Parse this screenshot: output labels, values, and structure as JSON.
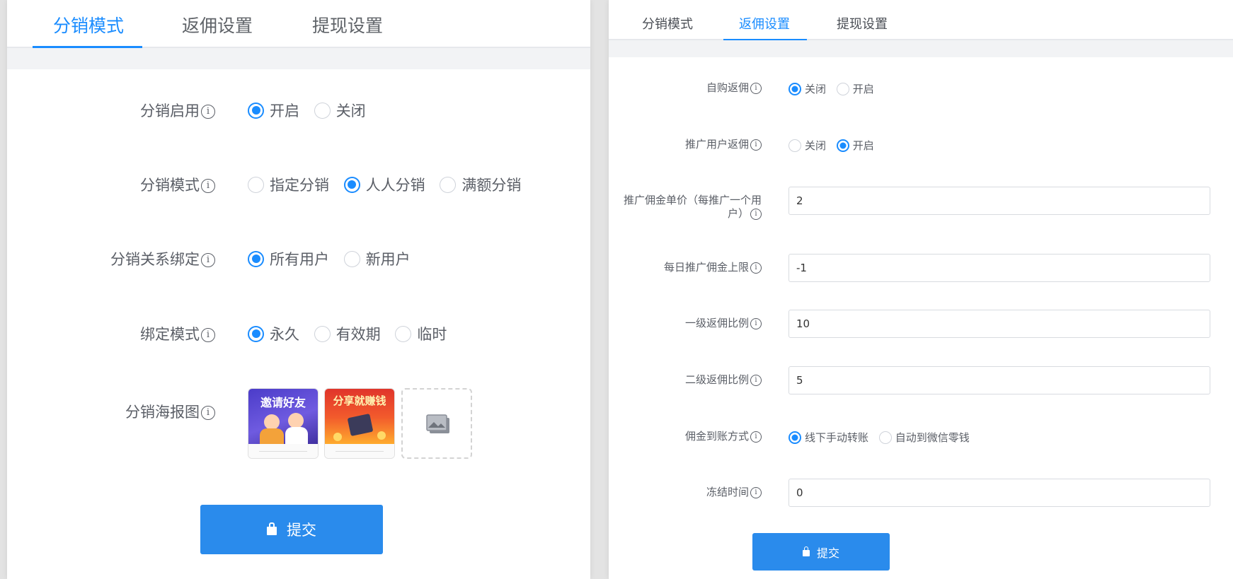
{
  "left_panel": {
    "tabs": [
      "分销模式",
      "返佣设置",
      "提现设置"
    ],
    "active_tab": "分销模式",
    "fields": {
      "enable": {
        "label": "分销启用",
        "options": [
          "开启",
          "关闭"
        ],
        "selected": "开启"
      },
      "mode": {
        "label": "分销模式",
        "options": [
          "指定分销",
          "人人分销",
          "满额分销"
        ],
        "selected": "人人分销"
      },
      "binding": {
        "label": "分销关系绑定",
        "options": [
          "所有用户",
          "新用户"
        ],
        "selected": "所有用户"
      },
      "bind_mode": {
        "label": "绑定模式",
        "options": [
          "永久",
          "有效期",
          "临时"
        ],
        "selected": "永久"
      },
      "poster": {
        "label": "分销海报图",
        "images": [
          "邀请好友",
          "分享就赚钱"
        ]
      }
    },
    "submit_label": "提交"
  },
  "right_panel": {
    "tabs": [
      "分销模式",
      "返佣设置",
      "提现设置"
    ],
    "active_tab": "返佣设置",
    "fields": {
      "self_purchase": {
        "label": "自购返佣",
        "options": [
          "关闭",
          "开启"
        ],
        "selected": "关闭"
      },
      "promote_user": {
        "label": "推广用户返佣",
        "options": [
          "关闭",
          "开启"
        ],
        "selected": "开启"
      },
      "unit_price": {
        "label_line1": "推广佣金单价（每推广一个用",
        "label_line2": "户）",
        "value": "2"
      },
      "daily_limit": {
        "label": "每日推广佣金上限",
        "value": "-1"
      },
      "level1_ratio": {
        "label": "一级返佣比例",
        "value": "10"
      },
      "level2_ratio": {
        "label": "二级返佣比例",
        "value": "5"
      },
      "payout_method": {
        "label": "佣金到账方式",
        "options": [
          "线下手动转账",
          "自动到微信零钱"
        ],
        "selected": "线下手动转账"
      },
      "freeze_time": {
        "label": "冻结时间",
        "value": "0"
      }
    },
    "submit_label": "提交"
  },
  "info_glyph": "i",
  "colors": {
    "accent": "#1a8cff",
    "button": "#2a8bec",
    "text": "#5a5e66",
    "strip": "#f2f3f5"
  }
}
